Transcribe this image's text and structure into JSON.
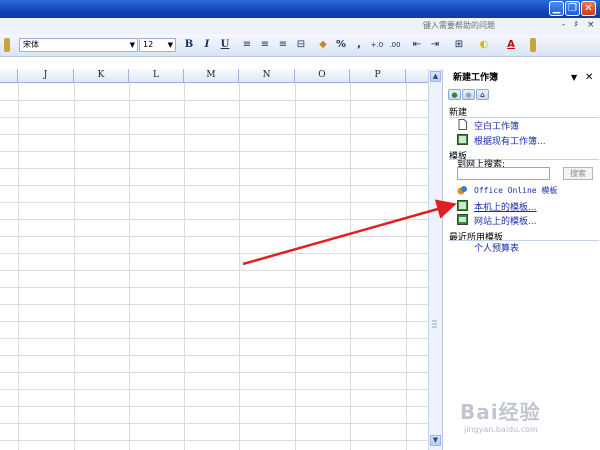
{
  "window": {
    "help_placeholder": "键入需要帮助的问题",
    "mdi_min": "-",
    "mdi_restore": "♯",
    "mdi_close": "×"
  },
  "toolbar": {
    "font_name": "宋体",
    "font_size": "12",
    "bold": "B",
    "italic": "I",
    "underline": "U",
    "percent": "%",
    "comma": ",",
    "font_color_letter": "A"
  },
  "sheet": {
    "columns": [
      "J",
      "K",
      "L",
      "M",
      "N",
      "O",
      "P"
    ]
  },
  "task_pane": {
    "title": "新建工作簿",
    "sections": {
      "new": {
        "title": "新建",
        "items": [
          "空白工作簿",
          "根据现有工作簿..."
        ]
      },
      "templates": {
        "title": "模板",
        "search_label": "到网上搜索:",
        "search_button": "搜索",
        "items": [
          "Office Online 模板",
          "本机上的模板...",
          "网站上的模板..."
        ]
      },
      "recent": {
        "title": "最近所用模板",
        "items": [
          "个人预算表"
        ]
      }
    }
  },
  "annotation": {
    "color": "#e02020",
    "points_to": "本机上的模板..."
  },
  "watermark": {
    "logo": "Bai经验",
    "url": "jingyan.baidu.com"
  },
  "colors": {
    "title_bar": "#1446b8",
    "link": "#1b2eb0",
    "grid": "#dcdcdc"
  }
}
